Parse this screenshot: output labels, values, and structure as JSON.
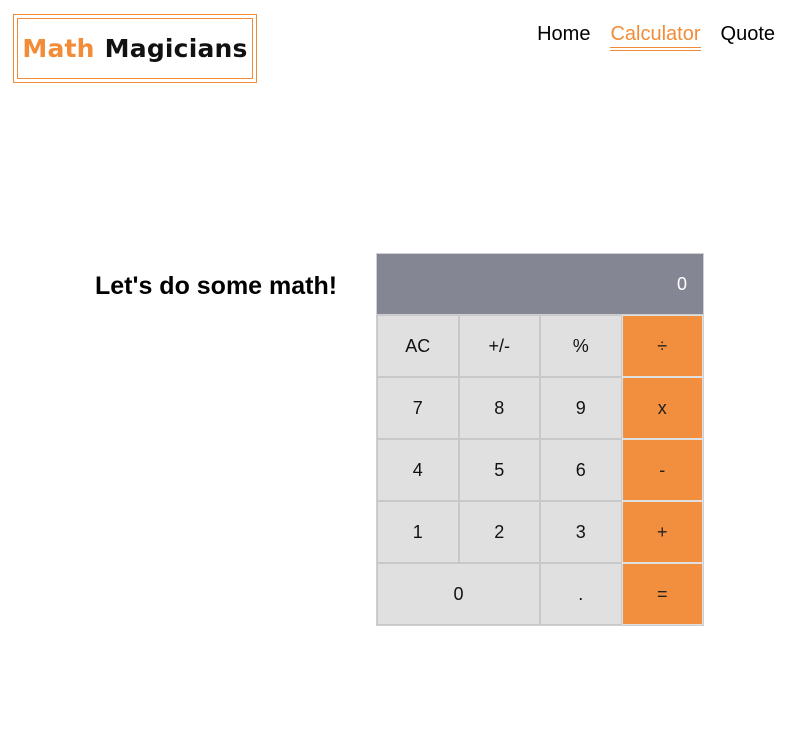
{
  "logo": {
    "word1": "Math",
    "word2": "Magicians"
  },
  "nav": {
    "items": [
      {
        "label": "Home"
      },
      {
        "label": "Calculator"
      },
      {
        "label": "Quote"
      }
    ],
    "active": "Calculator"
  },
  "heading": "Let's do some math!",
  "calculator": {
    "display": "0",
    "keys": [
      "AC",
      "+/-",
      "%",
      "÷",
      "7",
      "8",
      "9",
      "x",
      "4",
      "5",
      "6",
      "-",
      "1",
      "2",
      "3",
      "+",
      "0",
      ".",
      "="
    ]
  },
  "colors": {
    "accent": "#f28c38",
    "display_bg": "#858694",
    "key_bg": "#e0e0e0"
  }
}
